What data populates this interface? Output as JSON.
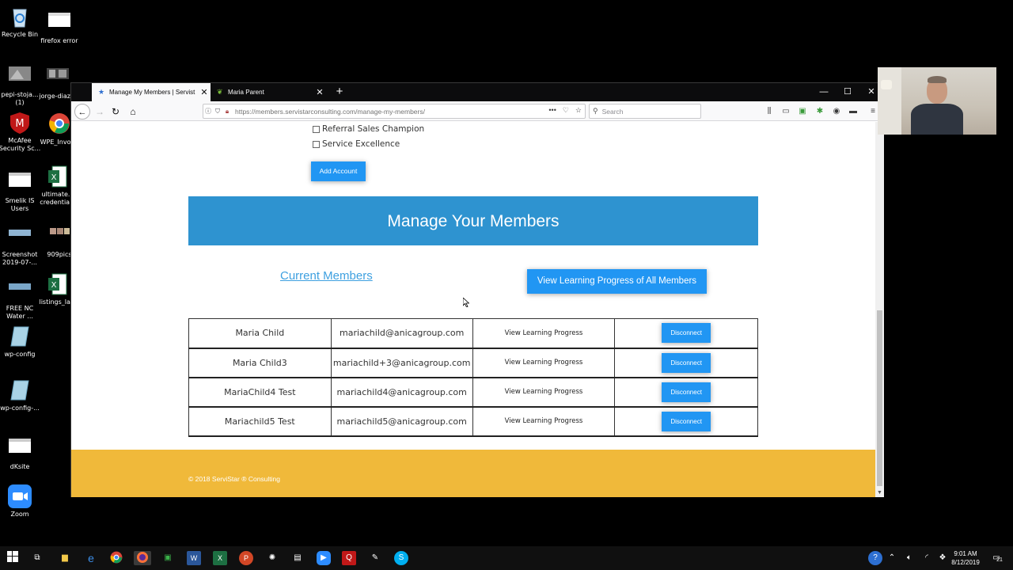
{
  "desktop": {
    "icons": [
      {
        "label": "Recycle Bin",
        "icon": "recycle-bin-icon"
      },
      {
        "label": "firefox error",
        "icon": "document-icon"
      },
      {
        "label": "pepi-stoja... (1)",
        "icon": "image-icon"
      },
      {
        "label": "jorge-diaz...",
        "icon": "image-icon"
      },
      {
        "label": "McAfee Security Sc...",
        "icon": "mcafee-icon"
      },
      {
        "label": "WPE_Invoi...",
        "icon": "chrome-icon"
      },
      {
        "label": "Smelik IS Users",
        "icon": "document-icon"
      },
      {
        "label": "ultimate... credentia...",
        "icon": "excel-icon"
      },
      {
        "label": "Screenshot 2019-07-...",
        "icon": "image-icon"
      },
      {
        "label": "909pics",
        "icon": "image-icon"
      },
      {
        "label": "FREE NC Water ...",
        "icon": "image-icon"
      },
      {
        "label": "listings_la...",
        "icon": "excel-icon"
      },
      {
        "label": "wp-config",
        "icon": "file-icon"
      },
      {
        "label": "wp-config-...",
        "icon": "file-icon"
      },
      {
        "label": "dKsite",
        "icon": "document-icon"
      },
      {
        "label": "Zoom",
        "icon": "zoom-icon"
      }
    ]
  },
  "browser": {
    "tabs": [
      {
        "title": "Manage My Members | Servist",
        "icon": "star-icon"
      },
      {
        "title": "Maria Parent",
        "icon": "leaf-icon"
      }
    ],
    "url_host": "https://members.servistarconsulting.com",
    "url_path": "/manage-my-members/",
    "search_placeholder": "Search",
    "window_controls": {
      "minimize": "—",
      "maximize": "☐",
      "close": "✕"
    }
  },
  "page": {
    "checkboxes": [
      {
        "label": "Referral Sales Champion",
        "checked": false
      },
      {
        "label": "Service Excellence",
        "checked": false
      }
    ],
    "add_account_label": "Add Account",
    "banner_title": "Manage Your Members",
    "current_members_link": "Current Members",
    "view_all_label": "View Learning Progress of All Members",
    "members": [
      {
        "name": "Maria Child",
        "email": "mariachild@anicagroup.com",
        "progress_label": "View Learning Progress",
        "disconnect_label": "Disconnect"
      },
      {
        "name": "Maria Child3",
        "email": "mariachild+3@anicagroup.com",
        "progress_label": "View Learning Progress",
        "disconnect_label": "Disconnect"
      },
      {
        "name": "MariaChild4 Test",
        "email": "mariachild4@anicagroup.com",
        "progress_label": "View Learning Progress",
        "disconnect_label": "Disconnect"
      },
      {
        "name": "Mariachild5 Test",
        "email": "mariachild5@anicagroup.com",
        "progress_label": "View Learning Progress",
        "disconnect_label": "Disconnect"
      }
    ],
    "footer_text": "© 2018 ServiStar ® Consulting",
    "colors": {
      "banner": "#2e93d0",
      "button": "#2196f3",
      "footer": "#f0b93a",
      "link": "#3ea0e0"
    }
  },
  "taskbar": {
    "time": "9:01 AM",
    "date": "8/12/2019",
    "notification_count": "21"
  }
}
